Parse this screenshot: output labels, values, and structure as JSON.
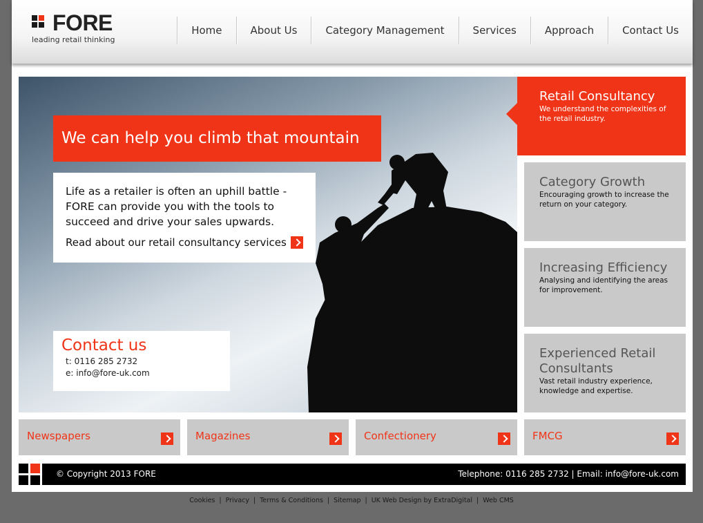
{
  "brand": {
    "name": "FORE",
    "tagline": "leading retail thinking",
    "accent": "#f03417"
  },
  "nav": {
    "items": [
      {
        "label": "Home"
      },
      {
        "label": "About Us"
      },
      {
        "label": "Category Management"
      },
      {
        "label": "Services"
      },
      {
        "label": "Approach"
      },
      {
        "label": "Contact Us"
      }
    ]
  },
  "hero": {
    "title": "We can help you climb that mountain",
    "body": "Life as a retailer is often an uphill battle - FORE can provide you with the tools to succeed and drive your sales upwards.",
    "link_text": "Read about our retail consultancy services",
    "link_icon": "arrow-right-icon"
  },
  "contact": {
    "title": "Contact us",
    "phone": "t: 0116 285 2732",
    "email": "e: info@fore-uk.com"
  },
  "panels": [
    {
      "title": "Retail Consultancy",
      "desc": "We understand the complexities of the retail industry.",
      "active": true
    },
    {
      "title": "Category Growth",
      "desc": "Encouraging growth to increase the return on your category."
    },
    {
      "title": "Increasing Efficiency",
      "desc": "Analysing and identifying the areas for improvement."
    },
    {
      "title": "Experienced Retail Consultants",
      "desc": "Vast retail industry experience, knowledge and expertise."
    }
  ],
  "categories": [
    {
      "label": "Newspapers"
    },
    {
      "label": "Magazines"
    },
    {
      "label": "Confectionery"
    },
    {
      "label": "FMCG"
    }
  ],
  "footer": {
    "copyright": "© Copyright 2013 FORE",
    "contact": "Telephone: 0116 285 2732  |  Email: info@fore-uk.com"
  },
  "bottom_links": [
    "Cookies",
    "Privacy",
    "Terms & Conditions",
    "Sitemap",
    "UK Web Design by ExtraDigital",
    "Web CMS"
  ],
  "bottom_sep": "|"
}
